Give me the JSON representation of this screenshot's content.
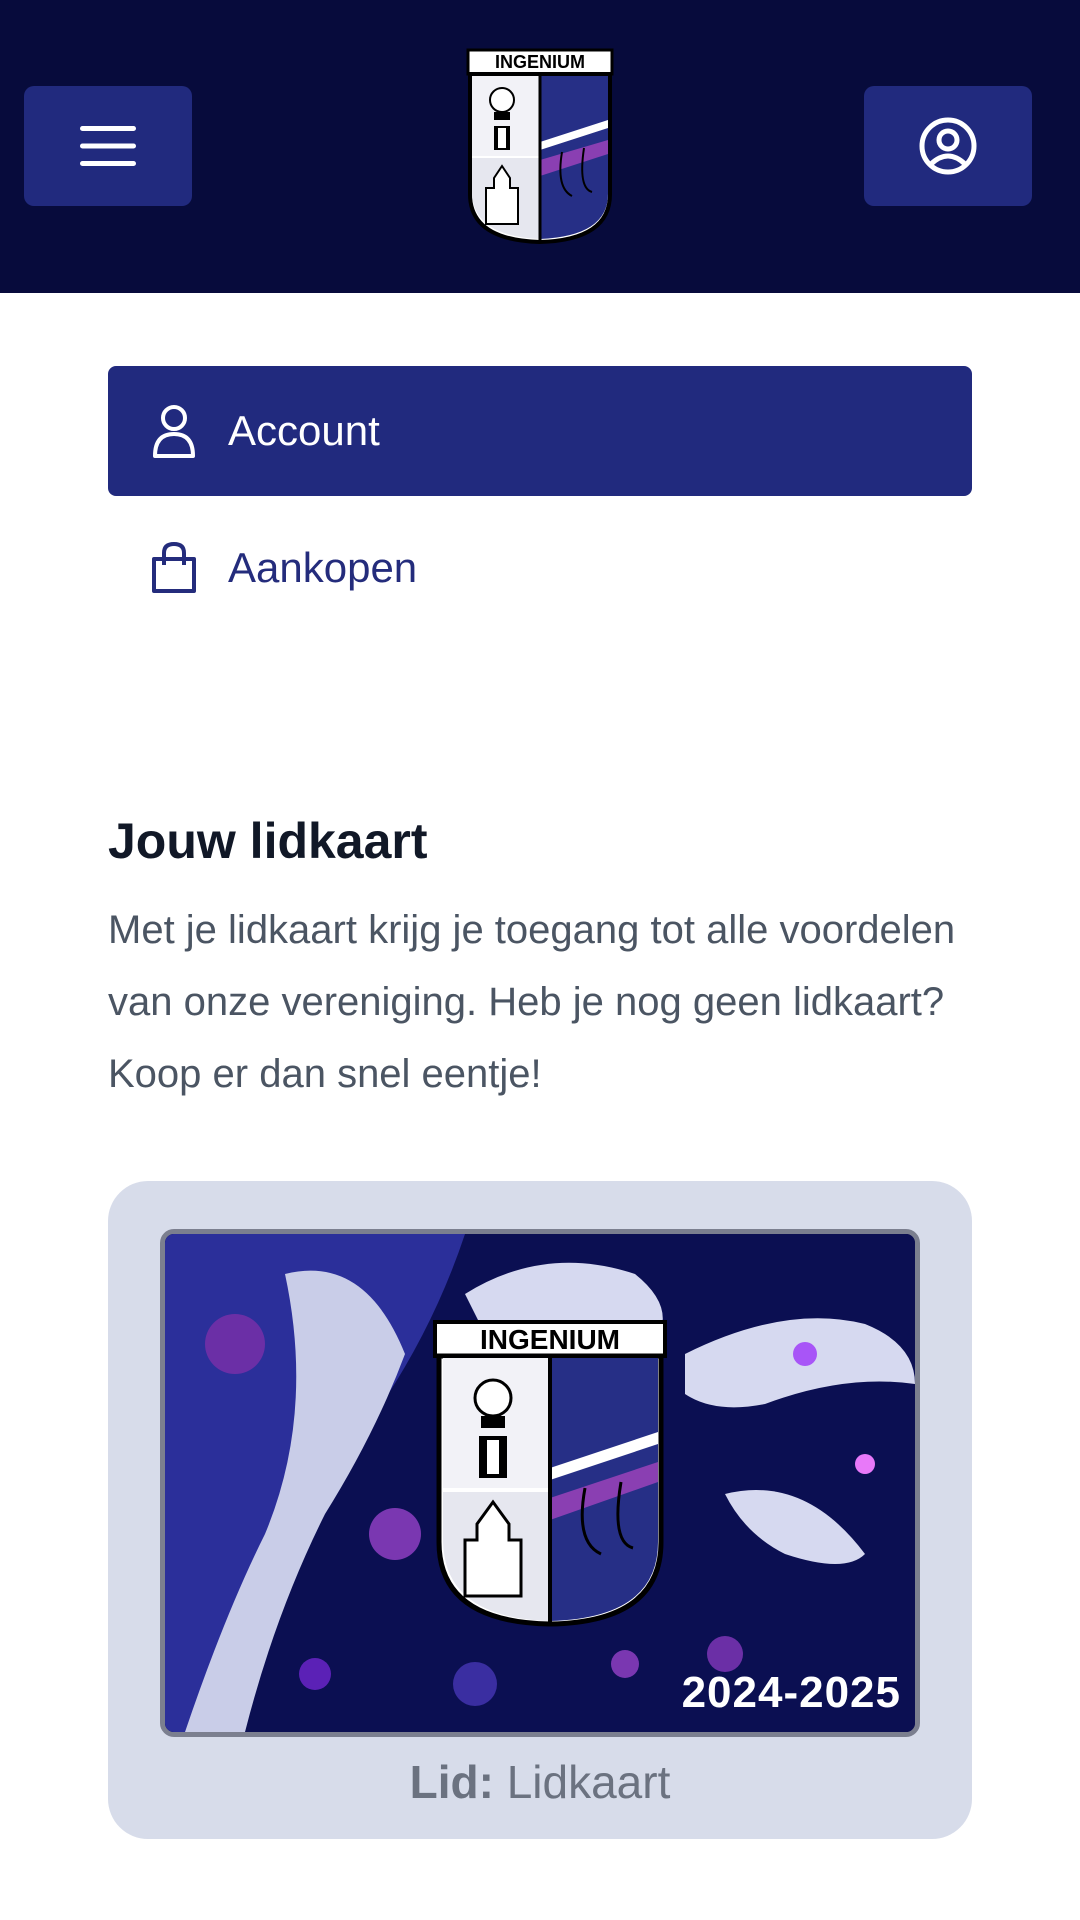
{
  "header": {
    "menu_icon": "hamburger-menu-icon",
    "profile_icon": "user-circle-icon",
    "logo_text": "INGENIUM"
  },
  "nav": {
    "items": [
      {
        "label": "Account",
        "icon": "user-icon",
        "active": true
      },
      {
        "label": "Aankopen",
        "icon": "shopping-bag-icon",
        "active": false
      }
    ]
  },
  "membership": {
    "title": "Jouw lidkaart",
    "description": "Met je lidkaart krijg je toegang tot alle voordelen van onze vereniging. Heb je nog geen lidkaart? Koop er dan snel eentje!",
    "card": {
      "logo_text": "INGENIUM",
      "year": "2024-2025",
      "caption_key": "Lid:",
      "caption_value": "Lidkaart"
    }
  },
  "colors": {
    "header_bg": "#070b3c",
    "accent": "#212a7e",
    "panel_bg": "#d7dcea"
  }
}
